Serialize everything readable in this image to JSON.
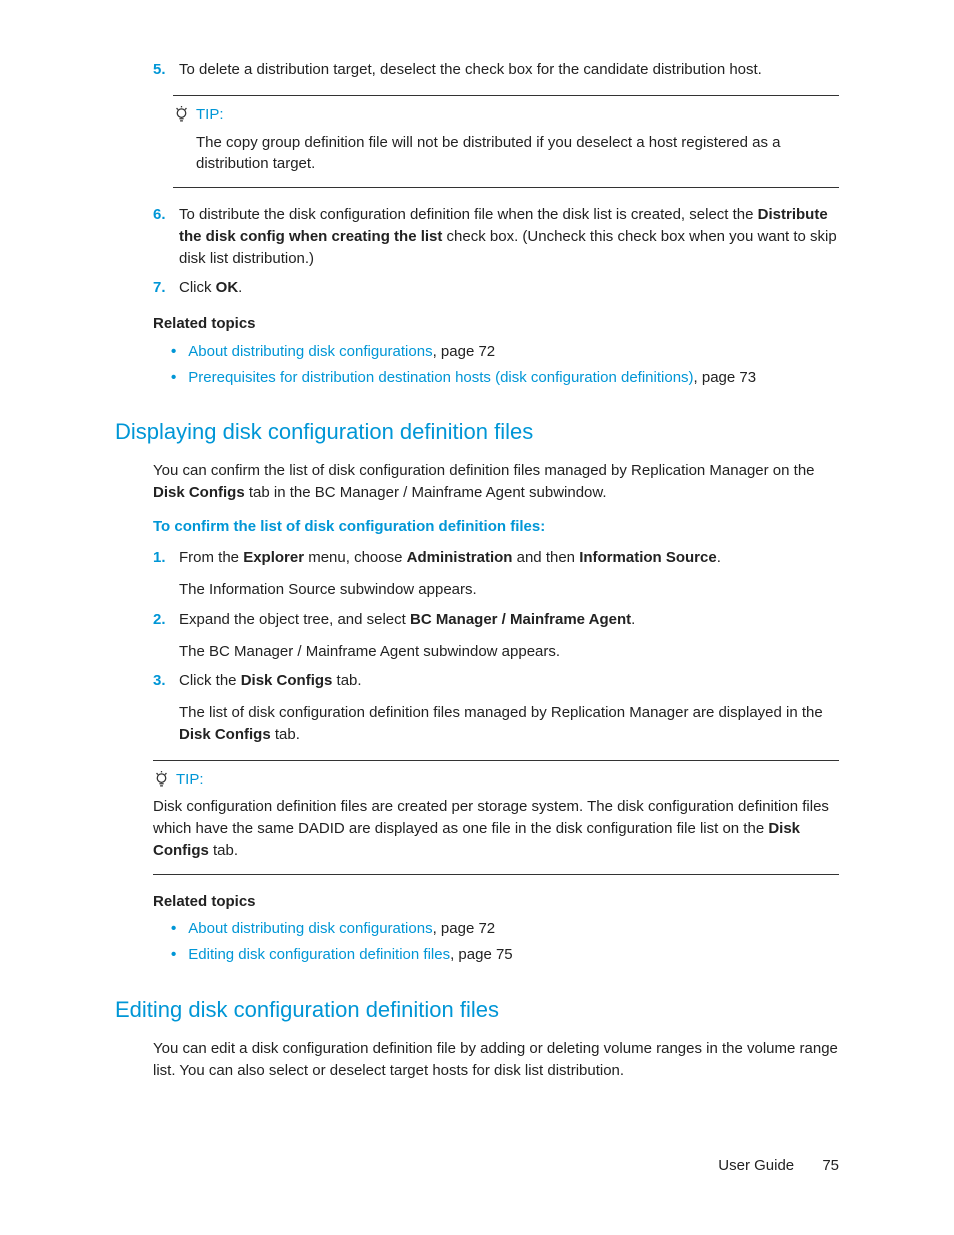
{
  "step5": {
    "num": "5.",
    "text_a": "To delete a distribution target, deselect the check box for the candidate distribution host."
  },
  "tip1": {
    "label": "TIP:",
    "body": "The copy group definition file will not be distributed if you deselect a host registered as a distribution target."
  },
  "step6": {
    "num": "6.",
    "a": "To distribute the disk configuration definition file when the disk list is created, select the ",
    "b": "Distribute the disk config when creating the list",
    "c": " check box. (Uncheck this check box when you want to skip disk list distribution.)"
  },
  "step7": {
    "num": "7.",
    "a": "Click ",
    "b": "OK",
    "c": "."
  },
  "related1": {
    "heading": "Related topics",
    "items": [
      {
        "link": "About distributing disk configurations",
        "suffix": ", page 72"
      },
      {
        "link": "Prerequisites for distribution destination hosts (disk configuration definitions)",
        "suffix": ", page 73"
      }
    ]
  },
  "section1": {
    "title": "Displaying disk configuration definition files",
    "intro_a": "You can confirm the list of disk configuration definition files managed by Replication Manager on the ",
    "intro_b": "Disk Configs",
    "intro_c": " tab in the BC Manager / Mainframe Agent subwindow.",
    "proc_heading": "To confirm the list of disk configuration definition files:",
    "steps": {
      "s1": {
        "num": "1.",
        "a": "From the ",
        "b": "Explorer",
        "c": " menu, choose ",
        "d": "Administration",
        "e": " and then ",
        "f": "Information Source",
        "g": ".",
        "sub": "The Information Source subwindow appears."
      },
      "s2": {
        "num": "2.",
        "a": "Expand the object tree, and select ",
        "b": "BC Manager / Mainframe Agent",
        "c": ".",
        "sub": "The BC Manager / Mainframe Agent subwindow appears."
      },
      "s3": {
        "num": "3.",
        "a": "Click the ",
        "b": "Disk Configs",
        "c": " tab.",
        "sub_a": "The list of disk configuration definition files managed by Replication Manager are displayed in the ",
        "sub_b": "Disk Configs",
        "sub_c": " tab."
      }
    }
  },
  "tip2": {
    "label": "TIP:",
    "body_a": "Disk configuration definition files are created per storage system. The disk configuration definition files which have the same DADID are displayed as one file in the disk configuration file list on the ",
    "body_b": "Disk Configs",
    "body_c": " tab."
  },
  "related2": {
    "heading": "Related topics",
    "items": [
      {
        "link": "About distributing disk configurations",
        "suffix": ", page 72"
      },
      {
        "link": "Editing disk configuration definition files",
        "suffix": ", page 75"
      }
    ]
  },
  "section2": {
    "title": "Editing disk configuration definition files",
    "intro": "You can edit a disk configuration definition file by adding or deleting volume ranges in the volume range list. You can also select or deselect target hosts for disk list distribution."
  },
  "footer": {
    "label": "User Guide",
    "page": "75"
  }
}
